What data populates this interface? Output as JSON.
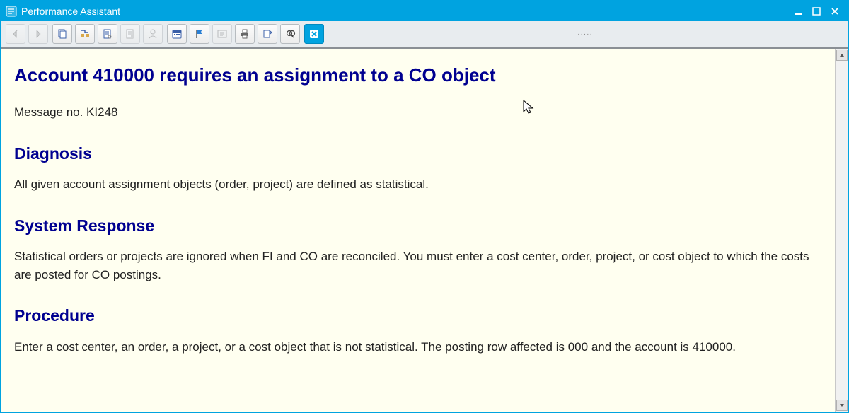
{
  "window": {
    "title": "Performance Assistant"
  },
  "toolbar": {
    "buttons": [
      {
        "name": "nav-back-icon",
        "hint": "Back"
      },
      {
        "name": "nav-forward-icon",
        "hint": "Forward"
      },
      {
        "name": "copy-icon",
        "hint": "Copy"
      },
      {
        "name": "tech-info-icon",
        "hint": "Technical Information"
      },
      {
        "name": "customize-icon",
        "hint": "Customizing"
      },
      {
        "name": "customize2-icon",
        "hint": "Maintenance"
      },
      {
        "name": "user-icon",
        "hint": "User"
      },
      {
        "name": "calendar-icon",
        "hint": "Appointment Calendar"
      },
      {
        "name": "flag-icon",
        "hint": "Flag"
      },
      {
        "name": "appl-help-icon",
        "hint": "Application Help"
      },
      {
        "name": "print-icon",
        "hint": "Print"
      },
      {
        "name": "export-icon",
        "hint": "Export"
      },
      {
        "name": "find-icon",
        "hint": "Find"
      },
      {
        "name": "close-help-icon",
        "hint": "Close"
      }
    ]
  },
  "message": {
    "title": "Account 410000 requires an assignment to a CO object",
    "message_no_label": "Message no. KI248",
    "diagnosis_heading": "Diagnosis",
    "diagnosis_text": "All given account assignment objects (order, project) are defined as statistical.",
    "system_response_heading": "System Response",
    "system_response_text": "Statistical orders or projects are ignored when FI and CO are reconciled. You must enter a cost center, order, project, or cost object to which the costs are posted for CO postings.",
    "procedure_heading": "Procedure",
    "procedure_text": "Enter a cost center, an order, a project, or a cost object that is not statistical. The posting row affected is 000 and the account is 410000."
  }
}
